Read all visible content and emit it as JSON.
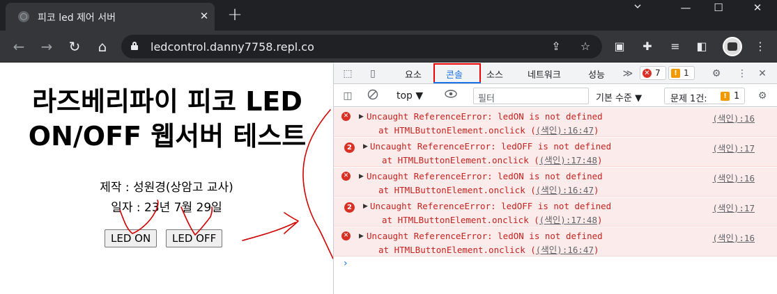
{
  "browser": {
    "tab_title": "피코 led 제어 서버",
    "tab_close": "✕",
    "new_tab": "+",
    "url": "ledcontrol.danny7758.repl.co",
    "window_controls": {
      "min": "—",
      "max": "☐",
      "close": "✕"
    },
    "nav": {
      "back": "←",
      "forward": "→",
      "reload": "↻",
      "home": "⌂"
    },
    "omni_icons": {
      "share": "⇪",
      "star": "☆"
    },
    "toolbar_icons": {
      "pip": "▣",
      "extensions": "✚",
      "media": "≡",
      "sidepanel": "◧",
      "menu": "⋮"
    }
  },
  "page": {
    "title_line1": "라즈베리파이 피코 LED",
    "title_line2": "ON/OFF 웹서버 테스트",
    "maker": "제작 : 성원경(상암고 교사)",
    "date": "일자 : 23년 7월 29일",
    "btn_on": "LED ON",
    "btn_off": "LED OFF"
  },
  "devtools": {
    "icons": {
      "inspect": "⬚",
      "device": "▯",
      "more_tabs": "≫",
      "settings": "⚙",
      "kebab": "⋮",
      "close": "✕",
      "sidebar": "◫",
      "clear": "⃠",
      "eye": "◉",
      "gear": "⚙"
    },
    "tabs": [
      "요소",
      "콘솔",
      "소스",
      "네트워크",
      "성능"
    ],
    "active_tab": "콘솔",
    "error_count": "7",
    "error_glyph": "✕",
    "warning_count": "1",
    "warning_glyph": "!",
    "context": "top ▼",
    "filter_placeholder": "필터",
    "levels": "기본 수준 ▼",
    "issues_label": "문제 1건:",
    "issues_count": "1",
    "prompt": "›",
    "messages": [
      {
        "repeat": "",
        "text": "Uncaught ReferenceError: ledON is not defined",
        "trace_prefix": "at HTMLButtonElement.onclick (",
        "trace_link": "(색인):16:47",
        "trace_suffix": ")",
        "source": "(색인):16"
      },
      {
        "repeat": "2",
        "text": "Uncaught ReferenceError: ledOFF is not defined",
        "trace_prefix": "at HTMLButtonElement.onclick (",
        "trace_link": "(색인):17:48",
        "trace_suffix": ")",
        "source": "(색인):17"
      },
      {
        "repeat": "",
        "text": "Uncaught ReferenceError: ledON is not defined",
        "trace_prefix": "at HTMLButtonElement.onclick (",
        "trace_link": "(색인):16:47",
        "trace_suffix": ")",
        "source": "(색인):16"
      },
      {
        "repeat": "2",
        "text": "Uncaught ReferenceError: ledOFF is not defined",
        "trace_prefix": "at HTMLButtonElement.onclick (",
        "trace_link": "(색인):17:48",
        "trace_suffix": ")",
        "source": "(색인):17"
      },
      {
        "repeat": "",
        "text": "Uncaught ReferenceError: ledON is not defined",
        "trace_prefix": "at HTMLButtonElement.onclick (",
        "trace_link": "(색인):16:47",
        "trace_suffix": ")",
        "source": "(색인):16"
      }
    ]
  },
  "colors": {
    "annotation": "#d00000",
    "error_bg": "#fcebeb",
    "error_text": "#c5221f",
    "active_tab_box": "#ee0000"
  }
}
